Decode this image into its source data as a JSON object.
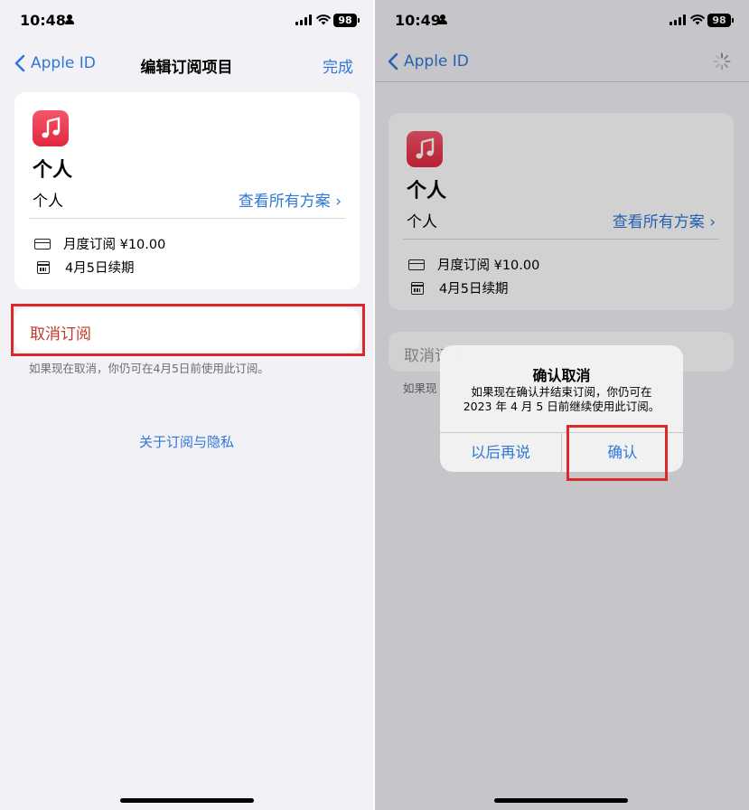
{
  "left": {
    "status": {
      "time": "10:48",
      "battery": "98"
    },
    "nav": {
      "back_label": "Apple ID",
      "title": "编辑订阅项目",
      "done_label": "完成"
    },
    "subscription": {
      "name": "个人",
      "plan": "个人",
      "see_all_plans": "查看所有方案 ›",
      "billing": "月度订阅 ¥10.00",
      "renewal": "4月5日续期"
    },
    "cancel_label": "取消订阅",
    "cancel_note": "如果现在取消，你仍可在4月5日前使用此订阅。",
    "privacy_link": "关于订阅与隐私"
  },
  "right": {
    "status": {
      "time": "10:49",
      "battery": "98"
    },
    "nav": {
      "back_label": "Apple ID"
    },
    "subscription": {
      "name": "个人",
      "plan": "个人",
      "see_all_plans": "查看所有方案 ›",
      "billing": "月度订阅 ¥10.00",
      "renewal": "4月5日续期"
    },
    "cancel_label": "取消订阅",
    "cancel_note": "如果现",
    "alert": {
      "title": "确认取消",
      "message_line1": "如果现在确认并结束订阅，你仍可在",
      "message_line2": "2023 年 4 月 5 日前继续使用此订阅。",
      "later_button": "以后再说",
      "confirm_button": "确认"
    }
  },
  "colors": {
    "accent": "#2f77d8",
    "destructive": "#c0392b",
    "highlight_box": "#d92a2a",
    "background": "#f2f1f6",
    "app_icon": "#e0283d"
  },
  "icons": [
    "chevron-left-icon",
    "music-note-icon",
    "credit-card-icon",
    "calendar-icon",
    "loading-spinner-icon",
    "cellular-signal-icon",
    "wifi-icon",
    "battery-icon",
    "person-icon"
  ]
}
